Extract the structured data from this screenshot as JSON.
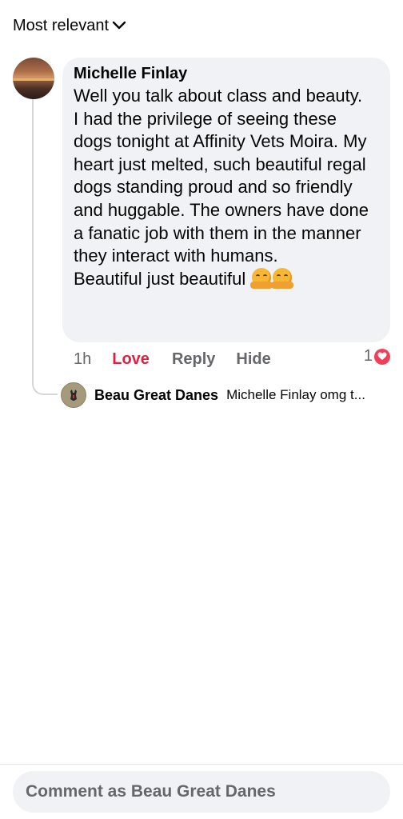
{
  "sort": {
    "label": "Most relevant"
  },
  "comment": {
    "author": "Michelle Finlay",
    "text": "Well you talk about class and beauty.\nI had the privilege of seeing these dogs tonight at Affinity Vets Moira. My heart just melted, such beautiful regal dogs standing proud and so friendly and huggable. The owners have done a fanatic job with them in the manner they interact with humans.\nBeautiful just beautiful",
    "emoji": [
      "hugging-face",
      "hugging-face"
    ],
    "time": "1h",
    "love_label": "Love",
    "reply_label": "Reply",
    "hide_label": "Hide",
    "reaction_count": "1",
    "reaction_icon": "heart-icon"
  },
  "reply": {
    "author": "Beau Great Danes",
    "preview": "Michelle Finlay omg t..."
  },
  "composer": {
    "placeholder": "Comment as Beau Great Danes"
  },
  "colors": {
    "bubble": "#f0f2f5",
    "love": "#e41e3f",
    "heart_badge": "#f33e58",
    "secondary_text": "#65676b"
  }
}
